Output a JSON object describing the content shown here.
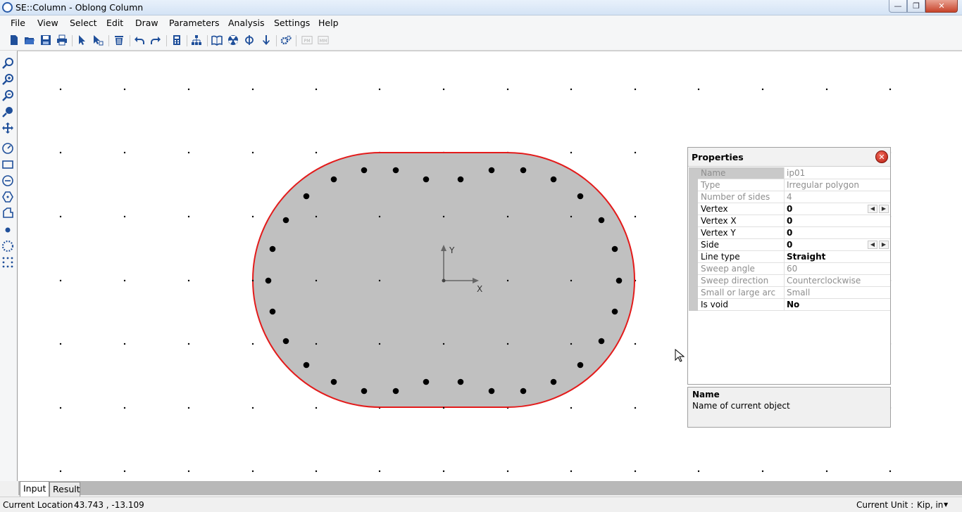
{
  "window": {
    "title": "SE::Column - Oblong Column",
    "min_glyph": "—",
    "max_glyph": "❐",
    "close_glyph": "✕"
  },
  "menu": [
    "File",
    "View",
    "Select",
    "Edit",
    "Draw",
    "Parameters",
    "Analysis",
    "Settings",
    "Help"
  ],
  "toolbar": {
    "icons": [
      "new-file-icon",
      "open-folder-icon",
      "save-icon",
      "print-icon",
      "select-arrow-icon",
      "select-window-icon",
      "delete-icon",
      "undo-icon",
      "redo-icon",
      "calculator-icon",
      "hierarchy-icon",
      "book-icon",
      "radiation-icon",
      "phi-icon",
      "arrow-down-icon",
      "settings-gears-icon",
      "pm-icon",
      "mm-icon"
    ],
    "pm_label": "PM",
    "mm_label": "MM"
  },
  "left_tools": [
    "zoom-icon",
    "zoom-in-icon",
    "zoom-out-icon",
    "zoom-extent-icon",
    "pan-icon",
    "circle-icon",
    "rectangle-icon",
    "circle-section-icon",
    "polygon-icon",
    "irregular-polygon-icon",
    "single-bar-icon",
    "circular-bars-icon",
    "rect-bars-icon"
  ],
  "canvas": {
    "axis_y_label": "Y",
    "axis_x_label": "X",
    "section_fill": "#c0c0c0",
    "section_outline": "#e31b1b"
  },
  "properties": {
    "title": "Properties",
    "close_glyph": "✕",
    "rows": [
      {
        "name": "Name",
        "value": "ip01",
        "disabled": true,
        "selected": true
      },
      {
        "name": "Type",
        "value": "Irregular polygon",
        "disabled": true
      },
      {
        "name": "Number of sides",
        "value": "4",
        "disabled": true
      },
      {
        "name": "Vertex",
        "value": "0",
        "bold": true,
        "spinner": true
      },
      {
        "name": "Vertex X",
        "value": "0",
        "bold": true
      },
      {
        "name": "Vertex Y",
        "value": "0",
        "bold": true
      },
      {
        "name": "Side",
        "value": "0",
        "bold": true,
        "spinner": true
      },
      {
        "name": "Line type",
        "value": "Straight",
        "bold": true
      },
      {
        "name": "Sweep angle",
        "value": "60",
        "disabled": true
      },
      {
        "name": "Sweep direction",
        "value": "Counterclockwise",
        "disabled": true
      },
      {
        "name": "Small or large arc",
        "value": "Small",
        "disabled": true
      },
      {
        "name": "Is void",
        "value": "No",
        "bold": true
      }
    ],
    "spinner_left": "◀",
    "spinner_right": "▶"
  },
  "description": {
    "title": "Name",
    "text": "Name of current object"
  },
  "tabs": [
    {
      "label": "Input",
      "active": true
    },
    {
      "label": "Result",
      "active": false
    }
  ],
  "status": {
    "location_label": "Current Location :",
    "location_value": "43.743 , -13.109",
    "unit_label": "Current Unit :",
    "unit_value": "Kip, in",
    "unit_arrow": "▼"
  }
}
